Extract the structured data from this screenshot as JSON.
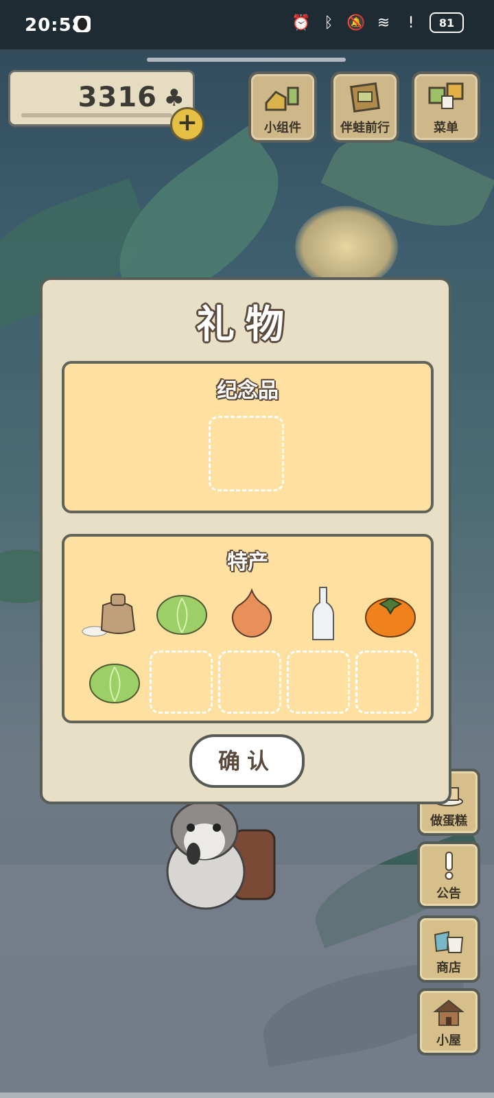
{
  "status_bar": {
    "time": "20:58",
    "battery": "81"
  },
  "currency": {
    "amount": "3316",
    "symbol": "♣"
  },
  "top_buttons": [
    {
      "label": "小组件",
      "icon": "widget-icon"
    },
    {
      "label": "伴蛙前行",
      "icon": "travel-book-icon"
    },
    {
      "label": "菜单",
      "icon": "menu-tiles-icon"
    }
  ],
  "side_buttons": [
    {
      "label": "做蛋糕",
      "icon": "cake-icon"
    },
    {
      "label": "公告",
      "icon": "exclamation-icon"
    },
    {
      "label": "商店",
      "icon": "shop-bags-icon"
    },
    {
      "label": "小屋",
      "icon": "house-icon"
    }
  ],
  "dialog": {
    "title": "礼物",
    "souvenir": {
      "title": "纪念品"
    },
    "specialty": {
      "title": "特产",
      "items": [
        {
          "icon": "rice-sack-icon"
        },
        {
          "icon": "cabbage-icon"
        },
        {
          "icon": "onion-icon"
        },
        {
          "icon": "bottle-icon"
        },
        {
          "icon": "persimmon-icon"
        },
        {
          "icon": "cabbage-icon"
        }
      ]
    },
    "confirm_label": "确认"
  }
}
